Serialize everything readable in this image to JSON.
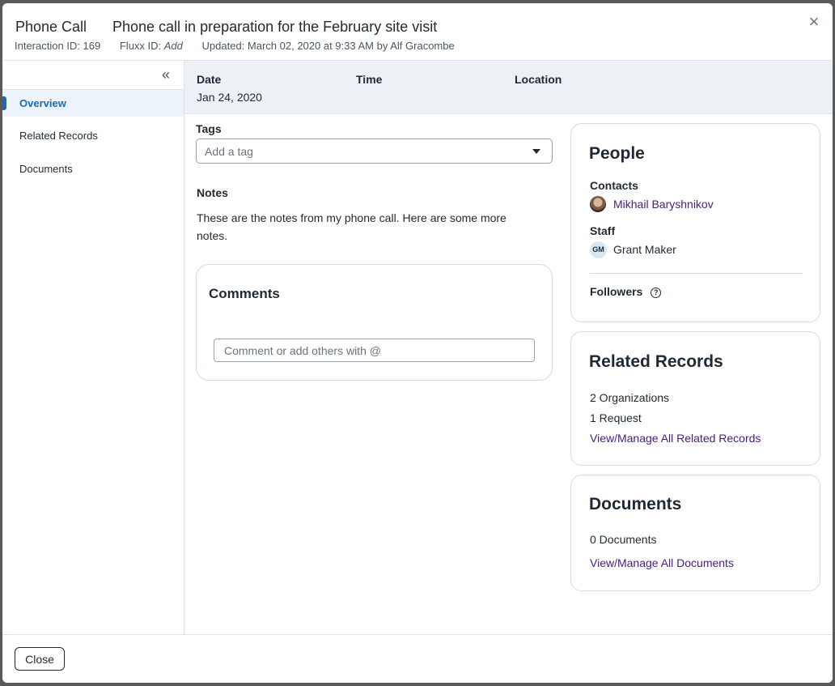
{
  "header": {
    "type": "Phone Call",
    "title": "Phone call in preparation for the February site visit",
    "interaction_id": "Interaction ID: 169",
    "fluxx_id_label": "Fluxx ID: ",
    "fluxx_id_value": "Add",
    "updated": "Updated: March 02, 2020 at 9:33 AM by Alf Gracombe",
    "close_icon": "close-icon"
  },
  "sidebar": {
    "collapse_icon": "double-chevron-left-icon",
    "items": [
      {
        "label": "Overview",
        "active": true
      },
      {
        "label": "Related Records",
        "active": false
      },
      {
        "label": "Documents",
        "active": false
      }
    ]
  },
  "info": {
    "date_label": "Date",
    "date_value": "Jan 24, 2020",
    "time_label": "Time",
    "location_label": "Location"
  },
  "tags": {
    "label": "Tags",
    "placeholder": "Add a tag"
  },
  "notes": {
    "label": "Notes",
    "text": "These are the notes from my phone call. Here are some more notes."
  },
  "comments": {
    "title": "Comments",
    "placeholder": "Comment or add others with @"
  },
  "people": {
    "title": "People",
    "contacts_label": "Contacts",
    "contact_name": "Mikhail Baryshnikov",
    "staff_label": "Staff",
    "staff_initials": "GM",
    "staff_name": "Grant Maker",
    "followers_label": "Followers"
  },
  "related_records": {
    "title": "Related Records",
    "organizations": "2 Organizations",
    "requests": "1 Request",
    "link": "View/Manage All Related Records"
  },
  "documents": {
    "title": "Documents",
    "count": "0 Documents",
    "link": "View/Manage All Documents"
  },
  "footer": {
    "close_label": "Close"
  },
  "colors": {
    "accent": "#1d6bb5",
    "link": "#4a1d7a",
    "info_bar_bg": "#edf1f6"
  }
}
